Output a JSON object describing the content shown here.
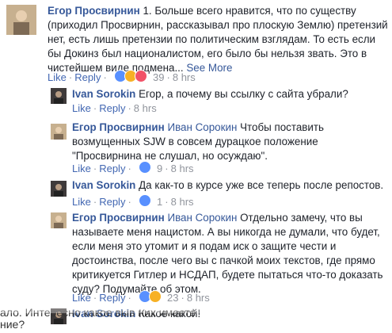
{
  "comments": [
    {
      "author": "Егор Просвирнин",
      "mention": "",
      "text": "1. Больше всего нравится, что по существу (приходил Просвирнин, рассказывал про плоскую Землю) претензий нет, есть лишь претензии по политическим взглядам. То есть если бы Докинз был националистом, его было бы нельзя звать. Это в чистейшем виде подмена...",
      "see_more": "See More",
      "like": "Like",
      "reply": "Reply",
      "reactions": 39,
      "time": "8 hrs"
    },
    {
      "author": "Ivan Sorokin",
      "mention": "",
      "text": "Егор, а почему вы ссылку с сайта убрали?",
      "like": "Like",
      "reply": "Reply",
      "time": "8 hrs"
    },
    {
      "author": "Егор Просвирнин",
      "mention": "Иван Сорокин",
      "text": "Чтобы поставить возмущенных SJW в совсем дурацкое положение \"Просвирнина не слушал, но осуждаю\".",
      "like": "Like",
      "reply": "Reply",
      "reactions": 9,
      "time": "8 hrs"
    },
    {
      "author": "Ivan Sorokin",
      "mention": "",
      "text": "Да как-то в курсе уже все теперь после репостов.",
      "like": "Like",
      "reply": "Reply",
      "reactions": 1,
      "time": "8 hrs"
    },
    {
      "author": "Егор Просвирнин",
      "mention": "Иван Сорокин",
      "text": "Отдельно замечу, что вы называете меня нацистом. А вы никогда не думали, что будет, если меня это утомит и я подам иск о защите чести и достоинства, после чего вы с пачкой моих текстов, где прямо критикуется Гитлер и НСДАП, будете пытаться что-то доказать суду? Подумайте об этом.",
      "like": "Like",
      "reply": "Reply",
      "reactions": 23,
      "time": "8 hrs"
    },
    {
      "author": "Ivan Sorokin",
      "mention": "",
      "text": "Какое какой!",
      "like": "",
      "reply": "",
      "time": ""
    }
  ],
  "background_text": {
    "line1": "ало. Интересно какое выв них имеете",
    "line2": "ние?"
  },
  "icons": {
    "like": "like-reaction-icon",
    "haha": "haha-reaction-icon",
    "love": "love-reaction-icon",
    "wow": "wow-reaction-icon",
    "sad": "sad-reaction-icon"
  },
  "colors": {
    "link": "#365899",
    "meta": "#90949c",
    "action": "#4267b2",
    "text": "#1d2129"
  }
}
